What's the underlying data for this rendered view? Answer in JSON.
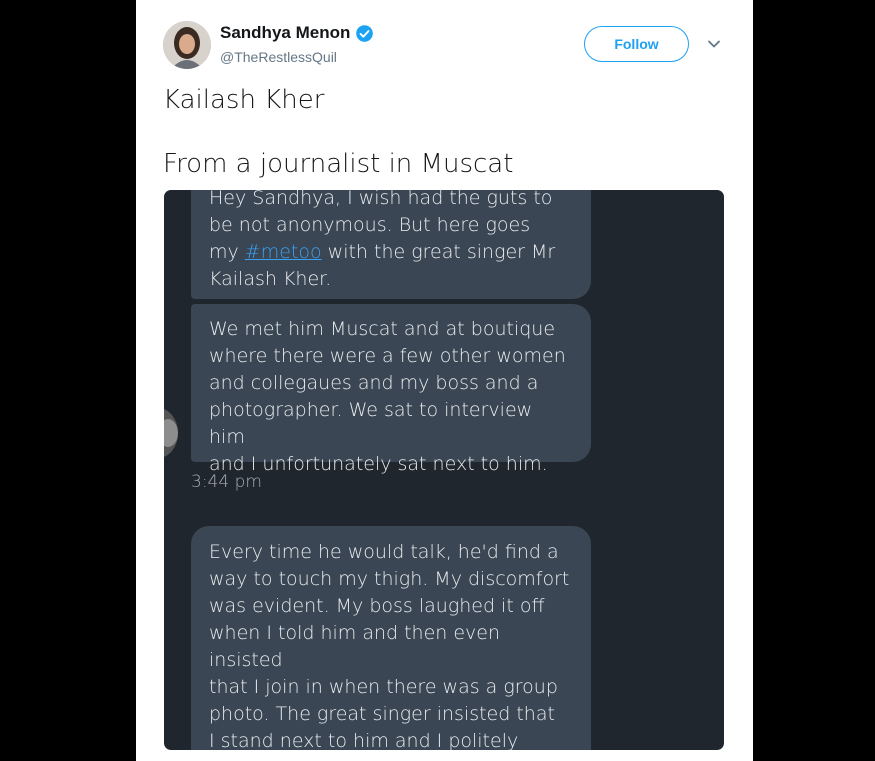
{
  "tweet": {
    "author_name": "Sandhya Menon",
    "handle": "@TheRestlessQuil",
    "follow_label": "Follow",
    "text_line1": "Kailash Kher",
    "text_line2": "From a journalist in Muscat"
  },
  "screenshot": {
    "msg1_pre": "Hey Sandhya, I wish had the guts to\nbe not anonymous. But here goes\nmy ",
    "msg1_tag": "#metoo",
    "msg1_post": " with the great singer Mr\nKailash Kher.",
    "msg2": "We met him Muscat and at boutique\nwhere there were a few other women\nand collegaues and my boss and a\nphotographer. We sat to interview him\nand I unfortunately sat next to him.",
    "time": "3:44 pm",
    "msg3": "Every time he would talk, he'd find a\nway to touch my thigh. My discomfort\nwas evident. My boss laughed it off\nwhen I told him and then even insisted\nthat I join in  when there was a group\nphoto. The great singer insisted that\nI stand next to him and I politely\nrefused. But the feeling of anger and"
  },
  "icons": {
    "verified": "verified-badge-icon",
    "chevron": "chevron-down-icon"
  },
  "colors": {
    "brand_blue": "#1da1f2",
    "bubble_bg": "#3a4653",
    "media_bg": "#20262e"
  }
}
